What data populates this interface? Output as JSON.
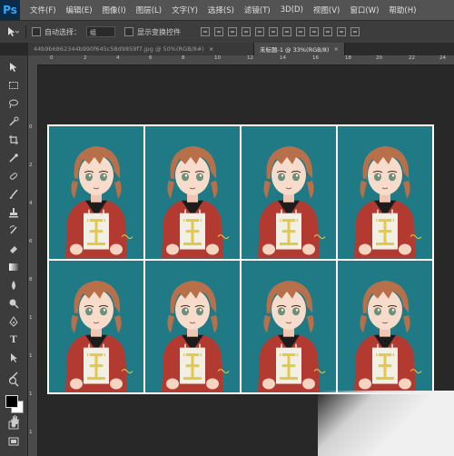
{
  "app": {
    "logo": "Ps"
  },
  "menu": [
    "文件(F)",
    "编辑(E)",
    "图像(I)",
    "图层(L)",
    "文字(Y)",
    "选择(S)",
    "滤镜(T)",
    "3D(D)",
    "视图(V)",
    "窗口(W)",
    "帮助(H)"
  ],
  "options": {
    "auto_select_label": "自动选择：",
    "auto_select_value": "组",
    "show_transform_label": "显示变换控件"
  },
  "tabs": [
    {
      "label": "44b9b6862344b990f645c58d9859f7.jpg @ 50%(RGB/8#)",
      "close": "×"
    },
    {
      "label": "未标题-1 @ 33%(RGB/8)",
      "close": "×"
    }
  ],
  "ruler": {
    "h": [
      "0",
      "2",
      "4",
      "6",
      "8",
      "10",
      "12",
      "14",
      "16",
      "18",
      "20",
      "22",
      "24"
    ],
    "v": [
      "0",
      "2",
      "4",
      "6",
      "8",
      "1",
      "1",
      "1",
      "1"
    ]
  },
  "canvas": {
    "rows": 2,
    "cols": 4,
    "photo_background": "#1f7a86"
  },
  "colors": {
    "foreground": "#000000",
    "background": "#ffffff"
  }
}
